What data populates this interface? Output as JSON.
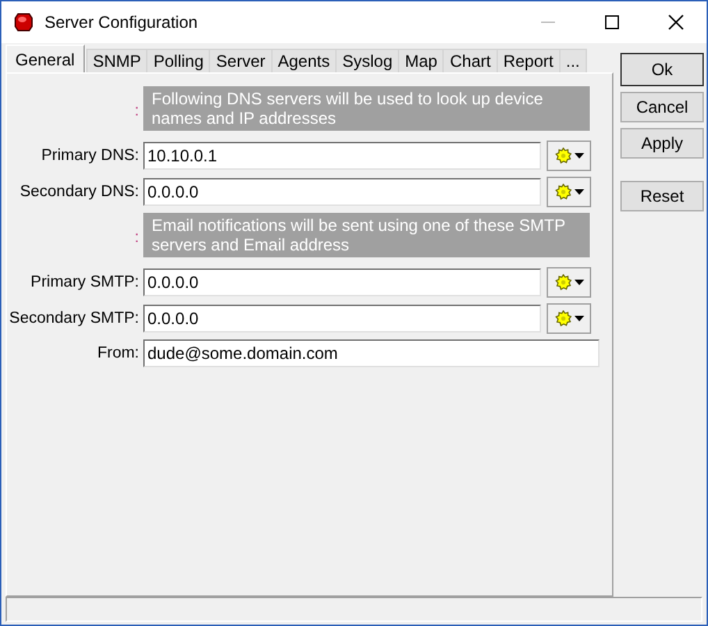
{
  "window": {
    "title": "Server Configuration"
  },
  "tabs": [
    {
      "label": "General",
      "selected": true
    },
    {
      "label": "SNMP",
      "selected": false
    },
    {
      "label": "Polling",
      "selected": false
    },
    {
      "label": "Server",
      "selected": false
    },
    {
      "label": "Agents",
      "selected": false
    },
    {
      "label": "Syslog",
      "selected": false
    },
    {
      "label": "Map",
      "selected": false
    },
    {
      "label": "Chart",
      "selected": false
    },
    {
      "label": "Report",
      "selected": false
    },
    {
      "label": "...",
      "selected": false
    }
  ],
  "form": [
    {
      "kind": "info",
      "marker": ":",
      "text": "Following DNS servers will be used to look up device names and IP addresses"
    },
    {
      "kind": "field",
      "label": "Primary DNS:",
      "value": "10.10.0.1",
      "picker": true
    },
    {
      "kind": "field",
      "label": "Secondary DNS:",
      "value": "0.0.0.0",
      "picker": true
    },
    {
      "kind": "info",
      "marker": ":",
      "text": "Email notifications will be sent using one of these SMTP servers and Email address"
    },
    {
      "kind": "field",
      "label": "Primary SMTP:",
      "value": "0.0.0.0",
      "picker": true
    },
    {
      "kind": "field",
      "label": "Secondary SMTP:",
      "value": "0.0.0.0",
      "picker": true
    },
    {
      "kind": "field",
      "label": "From:",
      "value": "dude@some.domain.com",
      "picker": false
    }
  ],
  "buttons": [
    {
      "label": "Ok",
      "default": true
    },
    {
      "label": "Cancel",
      "default": false
    },
    {
      "label": "Apply",
      "default": false
    },
    {
      "label": "Reset",
      "default": false
    }
  ]
}
